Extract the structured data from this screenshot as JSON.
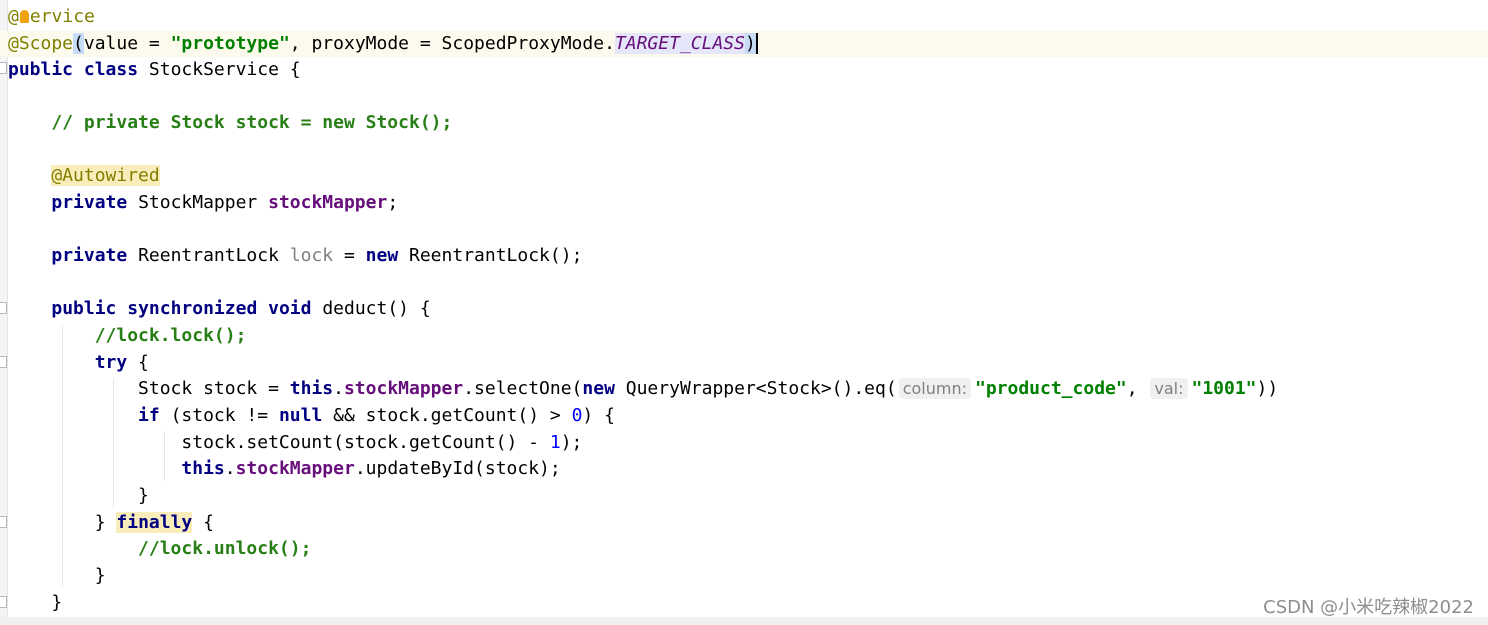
{
  "editor": {
    "lines": {
      "l1": {
        "at": "@",
        "bulb_icon": "lightbulb-icon",
        "rest": "ervice"
      },
      "l2": {
        "ann": "@Scope",
        "open": "(",
        "a1": "value = ",
        "s1": "\"prototype\"",
        "a2": ", proxyMode = ScopedProxyMode.",
        "const": "TARGET_CLASS",
        "close": ")"
      },
      "l3": {
        "k1": "public",
        "k2": "class",
        "name": "StockService {"
      },
      "l5": {
        "comment": "// private Stock stock = new Stock();"
      },
      "l7": {
        "ann": "@Autowired"
      },
      "l8": {
        "k": "private",
        "type": "StockMapper ",
        "field": "stockMapper",
        "end": ";"
      },
      "l10": {
        "k": "private",
        "type": "ReentrantLock ",
        "field": "lock",
        "mid": " = ",
        "k2": "new",
        "end": " ReentrantLock();"
      },
      "l12": {
        "k1": "public",
        "k2": "synchronized",
        "k3": "void",
        "end": "deduct() {"
      },
      "l13": {
        "comment": "//lock.lock();"
      },
      "l14": {
        "k": "try",
        "end": " {"
      },
      "l15": {
        "a": "Stock stock = ",
        "this": "this",
        "dot": ".",
        "field": "stockMapper",
        "b": ".selectOne(",
        "new": "new",
        "c": " QueryWrapper<Stock>().eq(",
        "hint1": "column:",
        "s1": "\"product_code\"",
        "comma": ", ",
        "hint2": "val:",
        "s2": "\"1001\"",
        "end": "))"
      },
      "l16": {
        "k": "if",
        "a": " (stock != ",
        "null": "null",
        "b": " && stock.getCount() > ",
        "num": "0",
        "end": ") {"
      },
      "l17": {
        "a": "stock.setCount(stock.getCount() - ",
        "num": "1",
        "end": ");"
      },
      "l18": {
        "this": "this",
        "dot": ".",
        "field": "stockMapper",
        "end": ".updateById(stock);"
      },
      "l19": {
        "text": "}"
      },
      "l20": {
        "a": "} ",
        "k": "finally",
        "end": " {"
      },
      "l21": {
        "comment": "//lock.unlock();"
      },
      "l22": {
        "text": "}"
      },
      "l23": {
        "text": "}"
      }
    }
  },
  "watermark": "CSDN @小米吃辣椒2022"
}
